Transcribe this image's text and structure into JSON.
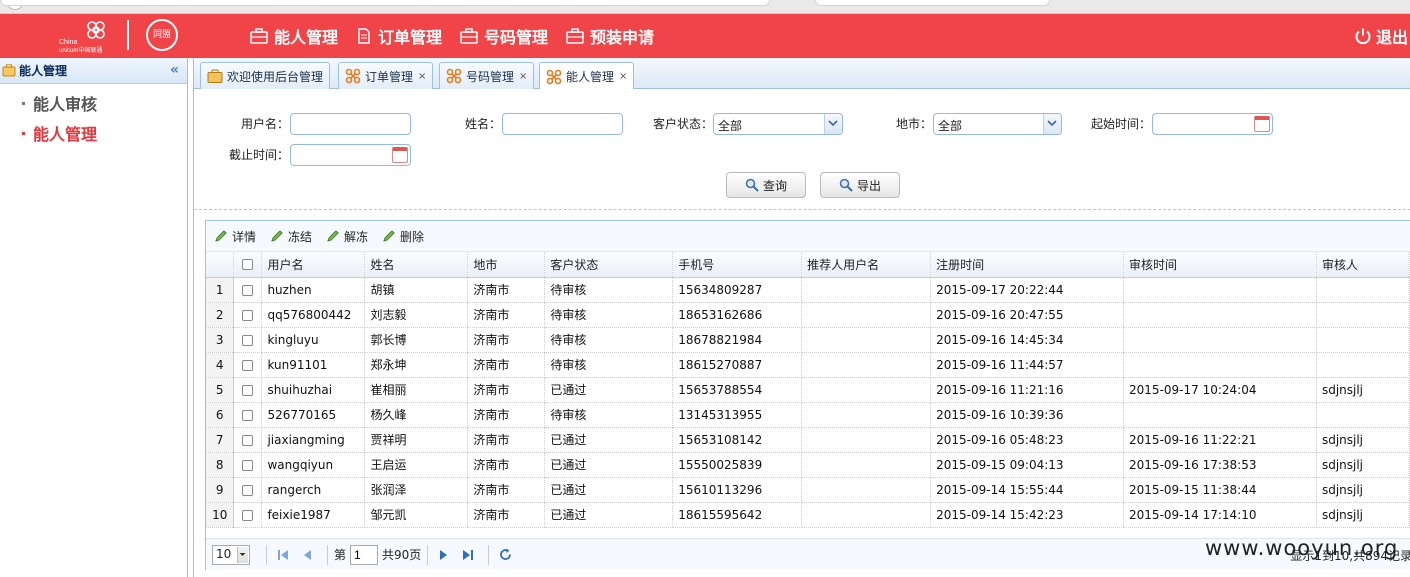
{
  "header": {
    "logo_text_a": "China",
    "logo_text_b": "unicom中国联通",
    "badge": "同盟",
    "nav": [
      {
        "label": "能人管理",
        "icon": "briefcase-icon"
      },
      {
        "label": "订单管理",
        "icon": "document-icon"
      },
      {
        "label": "号码管理",
        "icon": "briefcase-icon"
      },
      {
        "label": "预装申请",
        "icon": "briefcase-icon"
      }
    ],
    "logout_label": "退出"
  },
  "sidebar": {
    "title": "能人管理",
    "collapse": "«",
    "items": [
      {
        "label": "能人审核",
        "active": false
      },
      {
        "label": "能人管理",
        "active": true
      }
    ]
  },
  "tabs": [
    {
      "label": "欢迎使用后台管理",
      "closable": false
    },
    {
      "label": "订单管理",
      "closable": true
    },
    {
      "label": "号码管理",
      "closable": true
    },
    {
      "label": "能人管理",
      "closable": true,
      "active": true
    }
  ],
  "tab_close": "×",
  "form": {
    "username_label": "用户名：",
    "username_value": "",
    "name_label": "姓名：",
    "name_value": "",
    "status_label": "客户状态：",
    "status_value": "全部",
    "city_label": "地市：",
    "city_value": "全部",
    "start_label": "起始时间：",
    "start_value": "",
    "end_label": "截止时间：",
    "end_value": "",
    "search_label": "查询",
    "export_label": "导出"
  },
  "toolbar": {
    "detail": "详情",
    "freeze": "冻结",
    "unfreeze": "解冻",
    "delete": "删除"
  },
  "table": {
    "columns": [
      "用户名",
      "姓名",
      "地市",
      "客户状态",
      "手机号",
      "推荐人用户名",
      "注册时间",
      "审核时间",
      "审核人"
    ],
    "rows": [
      [
        "1",
        "huzhen",
        "胡镇",
        "济南市",
        "待审核",
        "15634809287",
        "",
        "2015-09-17 20:22:44",
        "",
        ""
      ],
      [
        "2",
        "qq576800442",
        "刘志毅",
        "济南市",
        "待审核",
        "18653162686",
        "",
        "2015-09-16 20:47:55",
        "",
        ""
      ],
      [
        "3",
        "kingluyu",
        "郭长博",
        "济南市",
        "待审核",
        "18678821984",
        "",
        "2015-09-16 14:45:34",
        "",
        ""
      ],
      [
        "4",
        "kun91101",
        "郑永坤",
        "济南市",
        "待审核",
        "18615270887",
        "",
        "2015-09-16 11:44:57",
        "",
        ""
      ],
      [
        "5",
        "shuihuzhai",
        "崔相丽",
        "济南市",
        "已通过",
        "15653788554",
        "",
        "2015-09-16 11:21:16",
        "2015-09-17 10:24:04",
        "sdjnsjlj"
      ],
      [
        "6",
        "526770165",
        "杨久峰",
        "济南市",
        "待审核",
        "13145313955",
        "",
        "2015-09-16 10:39:36",
        "",
        ""
      ],
      [
        "7",
        "jiaxiangming",
        "贾祥明",
        "济南市",
        "已通过",
        "15653108142",
        "",
        "2015-09-16 05:48:23",
        "2015-09-16 11:22:21",
        "sdjnsjlj"
      ],
      [
        "8",
        "wangqiyun",
        "王启运",
        "济南市",
        "已通过",
        "15550025839",
        "",
        "2015-09-15 09:04:13",
        "2015-09-16 17:38:53",
        "sdjnsjlj"
      ],
      [
        "9",
        "rangerch",
        "张润泽",
        "济南市",
        "已通过",
        "15610113296",
        "",
        "2015-09-14 15:55:44",
        "2015-09-15 11:38:44",
        "sdjnsjlj"
      ],
      [
        "10",
        "feixie1987",
        "邹元凯",
        "济南市",
        "已通过",
        "18615595642",
        "",
        "2015-09-14 15:42:23",
        "2015-09-14 17:14:10",
        "sdjnsjlj"
      ]
    ]
  },
  "pager": {
    "page_size": "10",
    "page_prefix": "第",
    "page_value": "1",
    "page_suffix": "共90页",
    "info": "显示1到10,共894记录"
  },
  "watermark": "www.wooyun.org",
  "colors": {
    "brand_red": "#f04448",
    "active_red": "#e8343a",
    "border_blue": "#9ec1e0"
  }
}
